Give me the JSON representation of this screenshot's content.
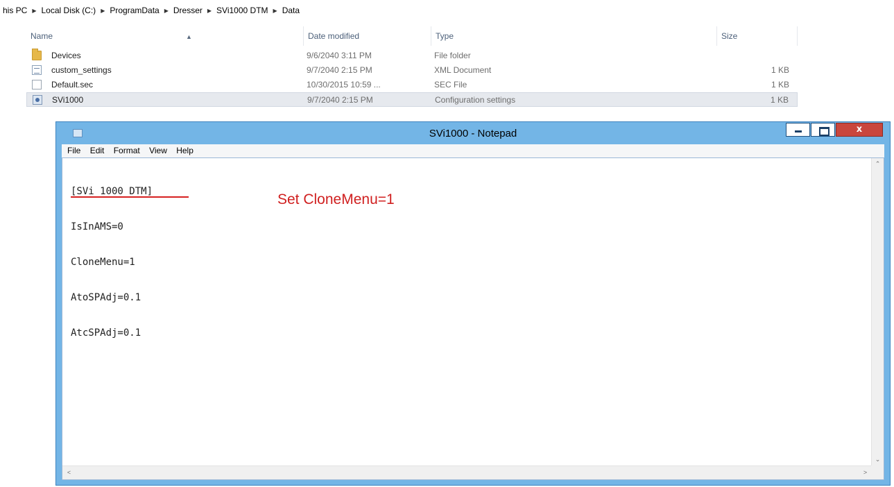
{
  "explorer": {
    "breadcrumb": [
      "his PC",
      "Local Disk (C:)",
      "ProgramData",
      "Dresser",
      "SVi1000 DTM",
      "Data"
    ],
    "columns": {
      "name": "Name",
      "date_modified": "Date modified",
      "type": "Type",
      "size": "Size"
    },
    "files": [
      {
        "name": "Devices",
        "date": "9/6/2040 3:11 PM",
        "type": "File folder",
        "size": "",
        "icon": "folder-icon"
      },
      {
        "name": "custom_settings",
        "date": "9/7/2040 2:15 PM",
        "type": "XML Document",
        "size": "1 KB",
        "icon": "xml-file-icon"
      },
      {
        "name": "Default.sec",
        "date": "10/30/2015 10:59 ...",
        "type": "SEC File",
        "size": "1 KB",
        "icon": "blank-file-icon"
      },
      {
        "name": "SVi1000",
        "date": "9/7/2040 2:15 PM",
        "type": "Configuration settings",
        "size": "1 KB",
        "icon": "config-file-icon",
        "selected": true
      }
    ]
  },
  "notepad": {
    "title": "SVi1000 - Notepad",
    "menu": [
      "File",
      "Edit",
      "Format",
      "View",
      "Help"
    ],
    "lines": [
      "[SVi 1000 DTM]",
      "IsInAMS=0",
      "CloneMenu=1",
      "AtoSPAdj=0.1",
      "AtcSPAdj=0.1"
    ],
    "close_glyph": "x"
  },
  "annotation": {
    "text": "Set CloneMenu=1",
    "color": "#d02020"
  },
  "colors": {
    "window_frame": "#73b5e6",
    "close_button": "#c9463d",
    "selected_row": "#e6e9ee"
  }
}
